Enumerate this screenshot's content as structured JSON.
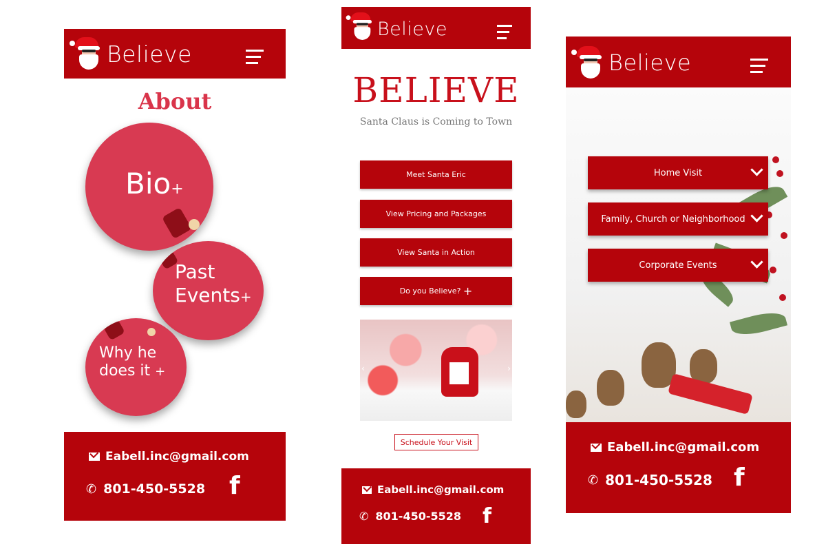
{
  "brand": {
    "logo_text": "Believe"
  },
  "screen1": {
    "heading": "About",
    "circles": [
      {
        "label": "Bio",
        "plus": "+"
      },
      {
        "label_line1": "Past",
        "label_line2": "Events",
        "plus": "+"
      },
      {
        "label_line1": "Why he",
        "label_line2": "does it",
        "plus": "+"
      }
    ]
  },
  "screen2": {
    "title": "BELIEVE",
    "subtitle": "Santa Claus is Coming to Town",
    "buttons": [
      "Meet Santa Eric",
      "View Pricing and Packages",
      "View Santa in Action",
      "Do you Believe?"
    ],
    "button4_plus": "+",
    "carousel_prev": "‹",
    "carousel_next": "›",
    "schedule_label": "Schedule Your Visit"
  },
  "screen3": {
    "dropdowns": [
      "Home Visit",
      "Family, Church or Neighborhood",
      "Corporate Events"
    ]
  },
  "contact": {
    "email": "Eabell.inc@gmail.com",
    "phone": "801-450-5528",
    "facebook": "f",
    "phone_icon": "✆"
  },
  "colors": {
    "primary": "#b5040b",
    "accent": "#d83a52",
    "title_red": "#c8101b"
  }
}
